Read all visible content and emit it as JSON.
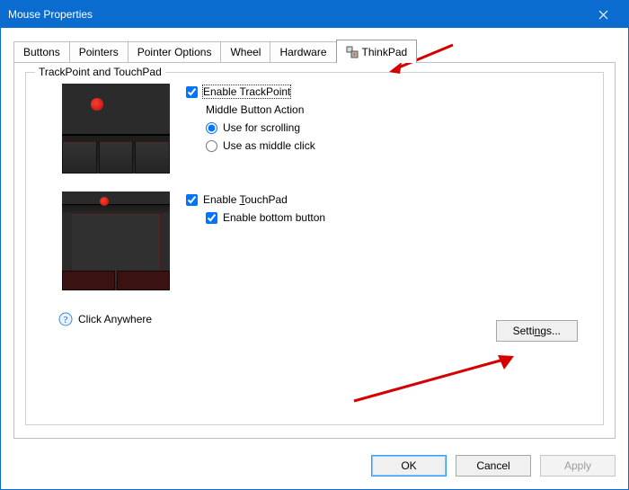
{
  "window": {
    "title": "Mouse Properties"
  },
  "tabs": [
    {
      "label": "Buttons"
    },
    {
      "label": "Pointers"
    },
    {
      "label": "Pointer Options"
    },
    {
      "label": "Wheel"
    },
    {
      "label": "Hardware"
    },
    {
      "label": "ThinkPad",
      "active": true
    }
  ],
  "group": {
    "title": "TrackPoint and TouchPad",
    "enable_trackpoint": "Enable TrackPoint",
    "middle_button_action": "Middle Button Action",
    "use_for_scrolling": "Use for scrolling",
    "use_as_middle_click": "Use as middle click",
    "enable_touchpad": "Enable TouchPad",
    "enable_bottom_button": "Enable bottom button",
    "click_anywhere": "Click Anywhere",
    "settings": "Settings..."
  },
  "buttons": {
    "ok": "OK",
    "cancel": "Cancel",
    "apply": "Apply"
  }
}
